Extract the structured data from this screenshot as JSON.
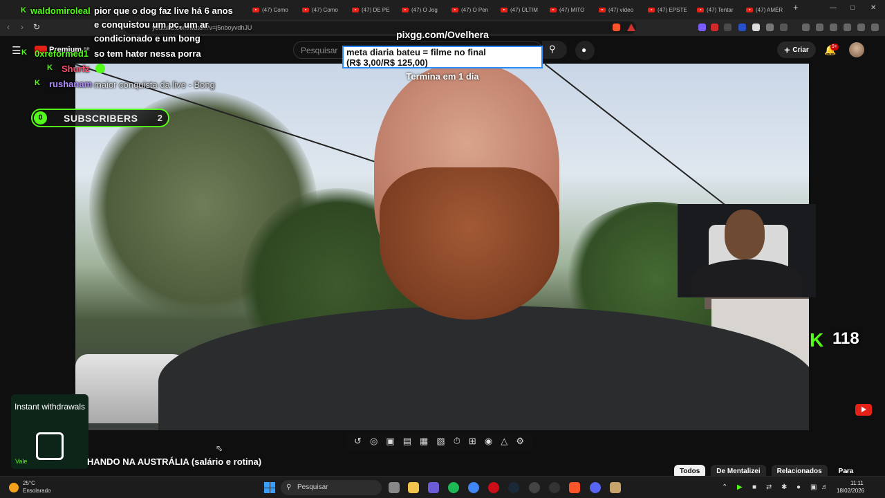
{
  "browser": {
    "tabs": [
      {
        "label": "(47) Como"
      },
      {
        "label": "(47) Como"
      },
      {
        "label": "(47) DE PE"
      },
      {
        "label": "(47) O Jog"
      },
      {
        "label": "(47) O Pen"
      },
      {
        "label": "(47) ÚLTIM"
      },
      {
        "label": "(47) MITO"
      },
      {
        "label": "(47) vídeo"
      },
      {
        "label": "(47) EPSTE"
      },
      {
        "label": "(47) Tentar"
      },
      {
        "label": "(47) AMÉR"
      }
    ],
    "new_tab": "+",
    "url": "youtube.com/watch?v=j5nboyvdhJU"
  },
  "youtube": {
    "logo_text": "Premium",
    "logo_region": "BR",
    "search_placeholder": "Pesquisar",
    "create_label": "Criar",
    "notif_badge": "9+"
  },
  "overlay": {
    "chat": [
      {
        "user": "waldomiroleal",
        "message": "pior que o dog faz live há 6 anos"
      },
      {
        "user": "",
        "message": "e conquistou um pc, um ar"
      },
      {
        "user": "",
        "message": "condicionado e um bong"
      },
      {
        "user": "",
        "message": "so tem hater nessa porra"
      },
      {
        "user": "0xreformed1",
        "message": ""
      },
      {
        "user": "Shurfz",
        "message": ""
      },
      {
        "user": "rushanam",
        "message": "maior conquista da live - Bong"
      }
    ],
    "pix": "pixgg.com/Ovelhera",
    "goal_line1": "meta diaria bateu = filme no final",
    "goal_line2": "(R$ 3,00/R$ 125,00)",
    "goal_ends": "Termina em 1 dia",
    "subs_left": "0",
    "subs_label": "SUBSCRIBERS",
    "subs_right": "2",
    "viewer_count": "118",
    "promo_title": "Instant withdrawals",
    "promo_foot": "Vale"
  },
  "colors": {
    "kick_green": "#53fc18",
    "youtube_red": "#e62117",
    "goal_border": "#2a8bff"
  },
  "video": {
    "title": "HANDO NA AUSTRÁLIA (salário e rotina)"
  },
  "chips": [
    {
      "label": "Todos",
      "active": true
    },
    {
      "label": "De Mentalizei",
      "active": false
    },
    {
      "label": "Relacionados",
      "active": false
    },
    {
      "label": "Para",
      "active": false
    }
  ],
  "taskbar": {
    "weather_temp": "25°C",
    "weather_desc": "Ensolarado",
    "search_label": "Pesquisar",
    "time": "11:11",
    "date": "18/02/2026"
  }
}
